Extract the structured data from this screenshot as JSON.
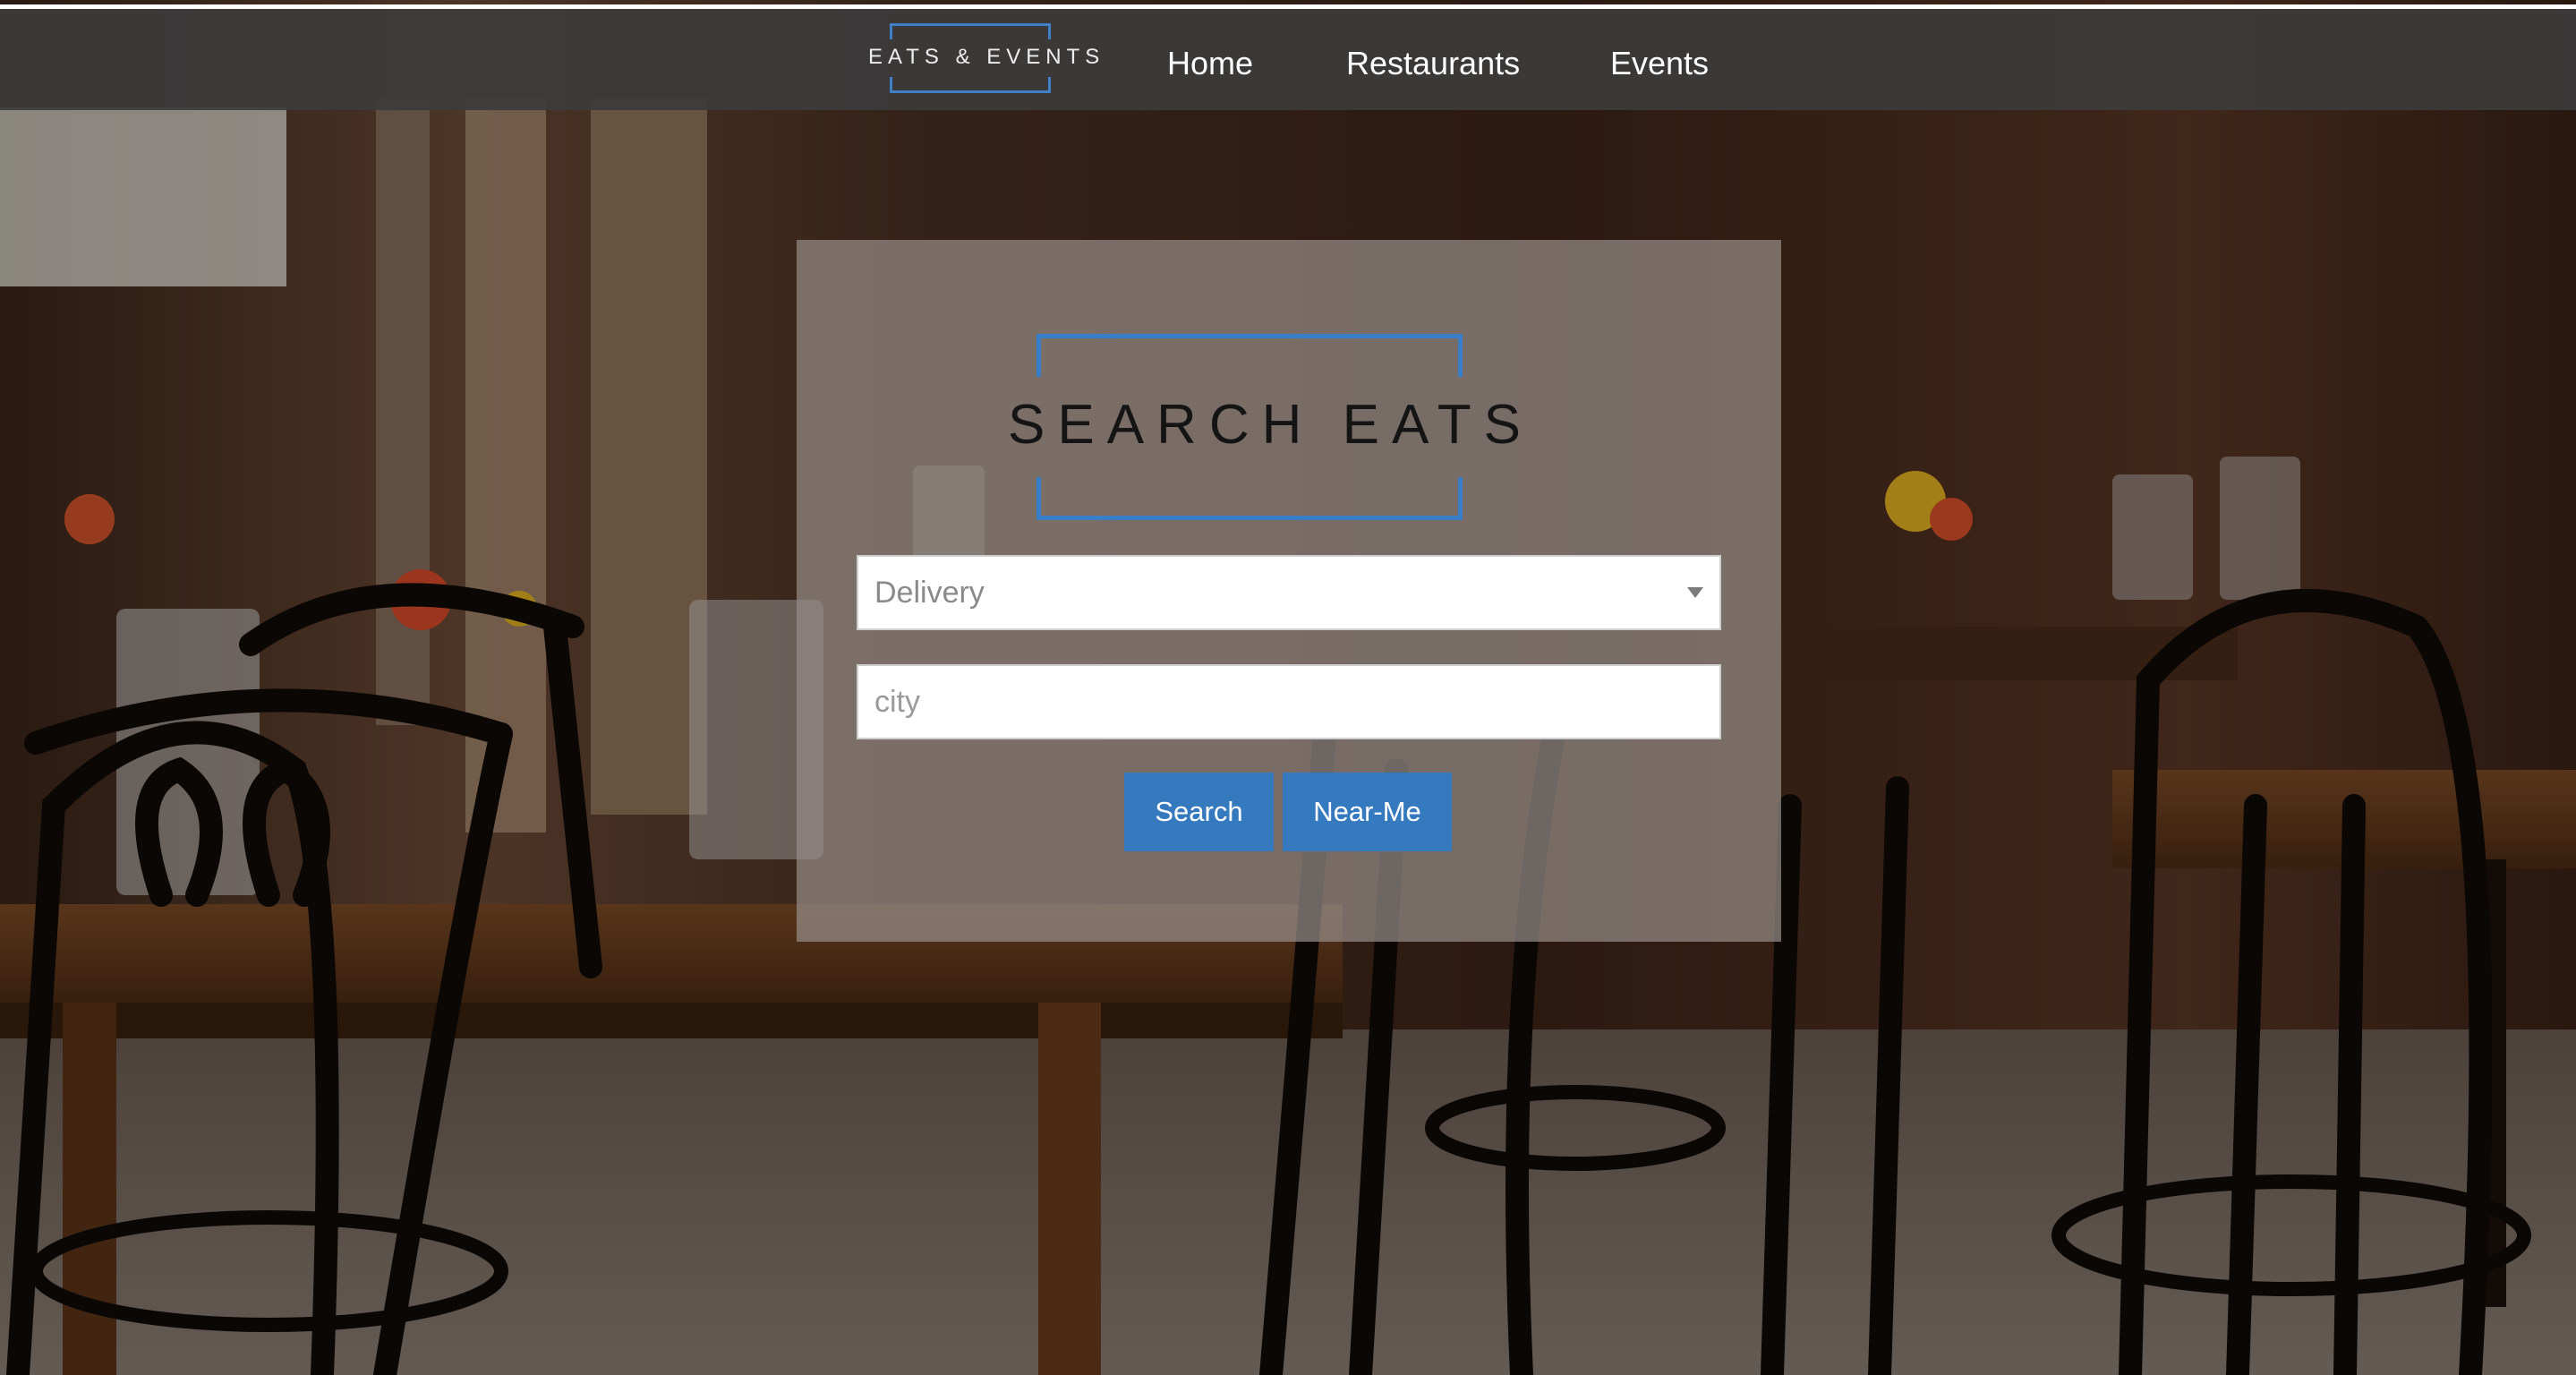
{
  "nav": {
    "logo_text": "EATS & EVENTS",
    "links": [
      {
        "label": "Home"
      },
      {
        "label": "Restaurants"
      },
      {
        "label": "Events"
      }
    ]
  },
  "search_panel": {
    "logo_text": "SEARCH EATS",
    "type_select": {
      "selected": "Delivery"
    },
    "city_input": {
      "value": "",
      "placeholder": "city"
    },
    "search_button": "Search",
    "near_me_button": "Near-Me"
  },
  "colors": {
    "accent_blue": "#3579bf",
    "logo_bracket_blue": "#3a7dc9",
    "navbar_bg": "#3c3c3c",
    "panel_bg": "#968c86"
  },
  "icons": {
    "select_caret": "caret-down-icon"
  }
}
